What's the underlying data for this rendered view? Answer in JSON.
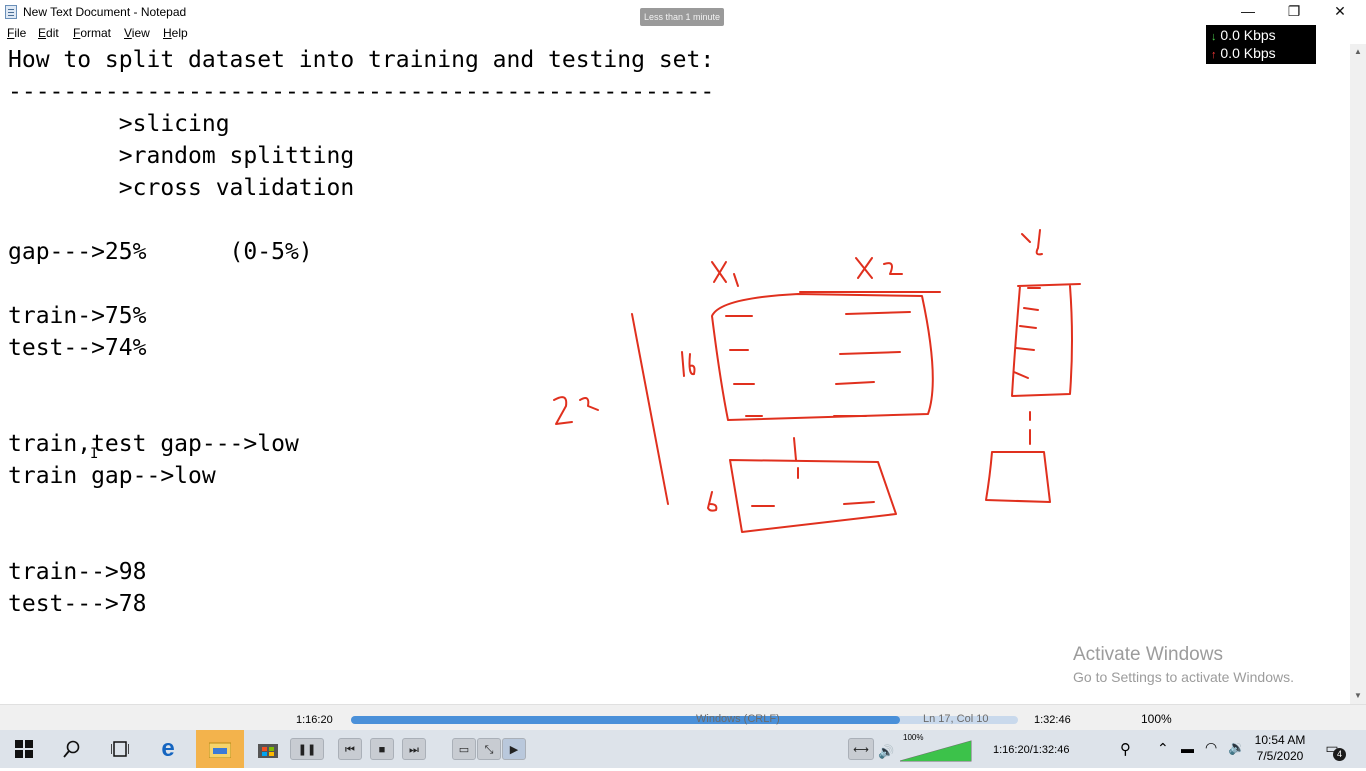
{
  "window": {
    "title": "New Text Document - Notepad",
    "tooltip": "Less than 1 minute",
    "minimize": "—",
    "restore": "❐",
    "close": "✕"
  },
  "menu": [
    {
      "underline": "F",
      "rest": "ile"
    },
    {
      "underline": "E",
      "rest": "dit"
    },
    {
      "underline": "F",
      "rest": "ormat",
      "pre": "",
      "alt": true
    },
    {
      "underline": "V",
      "rest": "iew"
    },
    {
      "underline": "H",
      "rest": "elp"
    }
  ],
  "network": {
    "down": "0.0 Kbps",
    "up": "0.0 Kbps"
  },
  "editor": {
    "lines": [
      "How to split dataset into training and testing set:",
      "---------------------------------------------------",
      "        >slicing",
      "        >random splitting",
      "        >cross validation",
      "",
      "gap--->25%      (0-5%)",
      "",
      "train->75%",
      "test-->74%",
      "",
      "",
      "train,test gap--->low",
      "train gap-->low",
      "",
      "",
      "train-->98",
      "test--->78"
    ]
  },
  "activate": {
    "title": "Activate Windows",
    "subtitle": "Go to Settings to activate Windows."
  },
  "statusbar": {
    "time_elapsed": "1:16:20",
    "encoding": "Windows (CRLF)",
    "position": "Ln 17, Col 10",
    "time_total": "1:32:46",
    "zoom": "100%",
    "progress": 0.823
  },
  "taskbar": {
    "volume_percent": "100%",
    "player_time": "1:16:20/1:32:46",
    "clock_time": "10:54 AM",
    "clock_date": "7/5/2020",
    "notification_count": "4"
  },
  "icons": [
    "windows-start-icon",
    "search-icon",
    "task-view-icon",
    "edge-icon",
    "file-explorer-icon",
    "store-icon"
  ]
}
